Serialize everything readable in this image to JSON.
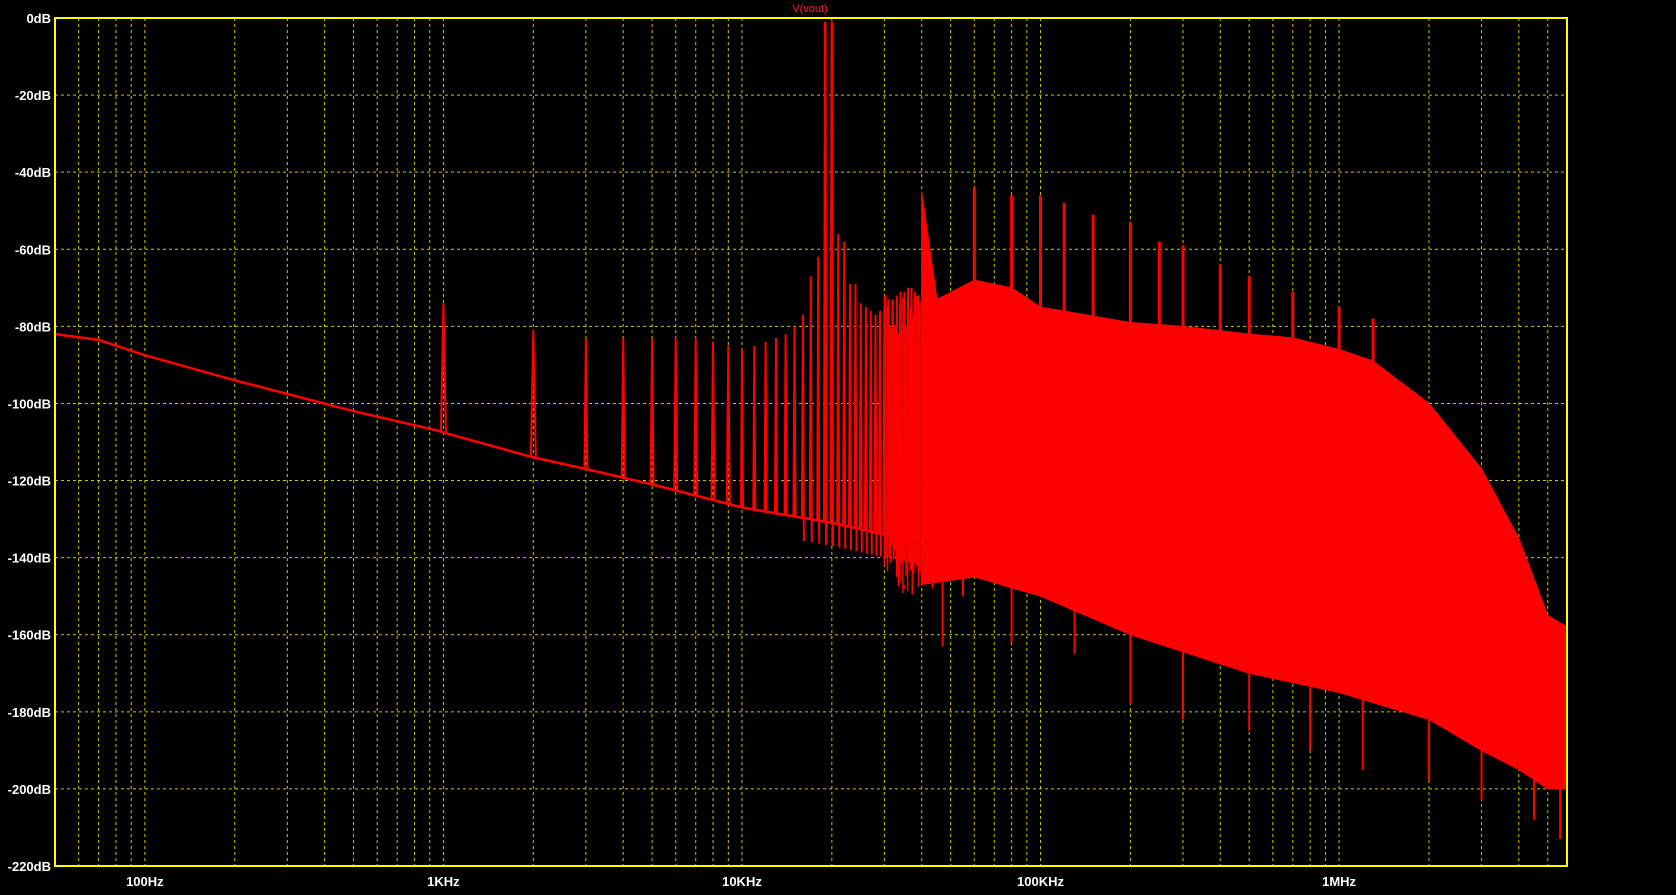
{
  "chart_data": {
    "type": "line",
    "title": "V(vout)",
    "xscale": "log",
    "xlim": [
      50,
      5800000
    ],
    "ylim": [
      -220,
      0
    ],
    "grid": true,
    "colors": {
      "background": "#000000",
      "frame": "#ffff00",
      "grid": "#c8c800",
      "trace": "#ff0000",
      "title": "#ff2020",
      "labels": "#ffffff"
    },
    "yticks": [
      {
        "value": 0,
        "label": "0dB"
      },
      {
        "value": -20,
        "label": "-20dB"
      },
      {
        "value": -40,
        "label": "-40dB"
      },
      {
        "value": -60,
        "label": "-60dB"
      },
      {
        "value": -80,
        "label": "-80dB"
      },
      {
        "value": -100,
        "label": "-100dB"
      },
      {
        "value": -120,
        "label": "-120dB"
      },
      {
        "value": -140,
        "label": "-140dB"
      },
      {
        "value": -160,
        "label": "-160dB"
      },
      {
        "value": -180,
        "label": "-180dB"
      },
      {
        "value": -200,
        "label": "-200dB"
      },
      {
        "value": -220,
        "label": "-220dB"
      }
    ],
    "xticks": [
      {
        "value": 100,
        "label": "100Hz"
      },
      {
        "value": 1000,
        "label": "1KHz"
      },
      {
        "value": 10000,
        "label": "10KHz"
      },
      {
        "value": 100000,
        "label": "100KHz"
      },
      {
        "value": 1000000,
        "label": "1MHz"
      }
    ],
    "series": [
      {
        "name": "V(vout)",
        "noise_floor": [
          [
            50,
            -82
          ],
          [
            70,
            -83.5
          ],
          [
            100,
            -87.5
          ],
          [
            200,
            -94
          ],
          [
            500,
            -102
          ],
          [
            950,
            -107
          ],
          [
            1050,
            -108
          ],
          [
            2000,
            -114
          ],
          [
            3000,
            -117
          ],
          [
            5000,
            -121
          ],
          [
            10000,
            -127
          ],
          [
            20000,
            -131
          ],
          [
            30000,
            -134
          ],
          [
            40000,
            -136
          ]
        ],
        "harmonics": [
          [
            1000,
            -74
          ],
          [
            2000,
            -81
          ],
          [
            3000,
            -83
          ],
          [
            4000,
            -83
          ],
          [
            5000,
            -83
          ],
          [
            6000,
            -83
          ],
          [
            7000,
            -83
          ],
          [
            8000,
            -84
          ],
          [
            9000,
            -85
          ],
          [
            10000,
            -86
          ],
          [
            11000,
            -85
          ],
          [
            12000,
            -84
          ],
          [
            13000,
            -83
          ],
          [
            14000,
            -82
          ],
          [
            15000,
            -80
          ],
          [
            16000,
            -77
          ],
          [
            17000,
            -67
          ],
          [
            18000,
            -62
          ],
          [
            19000,
            -1
          ],
          [
            20000,
            -1
          ],
          [
            21000,
            -56
          ],
          [
            22000,
            -58
          ],
          [
            23000,
            -69
          ],
          [
            24000,
            -69
          ],
          [
            25000,
            -74
          ],
          [
            26000,
            -75
          ],
          [
            27000,
            -76
          ],
          [
            28000,
            -77
          ],
          [
            29000,
            -76
          ],
          [
            30000,
            -75
          ],
          [
            31000,
            -73
          ],
          [
            32000,
            -73
          ],
          [
            33000,
            -72
          ],
          [
            34000,
            -71
          ],
          [
            35000,
            -71
          ],
          [
            36000,
            -70
          ],
          [
            37000,
            -70
          ],
          [
            38000,
            -71
          ],
          [
            39000,
            -72
          ]
        ],
        "band_top": [
          [
            40000,
            -45
          ],
          [
            45000,
            -73
          ],
          [
            60000,
            -68
          ],
          [
            80000,
            -70
          ],
          [
            100000,
            -75
          ],
          [
            200000,
            -79
          ],
          [
            300000,
            -80
          ],
          [
            500000,
            -82
          ],
          [
            700000,
            -83
          ],
          [
            1000000,
            -86
          ],
          [
            1300000,
            -89
          ],
          [
            2000000,
            -100
          ],
          [
            3000000,
            -117
          ],
          [
            4000000,
            -135
          ],
          [
            5000000,
            -155
          ],
          [
            5800000,
            -158
          ]
        ],
        "band_bottom": [
          [
            40000,
            -147
          ],
          [
            60000,
            -145
          ],
          [
            100000,
            -150
          ],
          [
            200000,
            -160
          ],
          [
            500000,
            -170
          ],
          [
            1000000,
            -175
          ],
          [
            2000000,
            -182
          ],
          [
            3000000,
            -190
          ],
          [
            4000000,
            -195
          ],
          [
            5000000,
            -200
          ],
          [
            5800000,
            -200
          ]
        ],
        "band_peaks": [
          [
            40000,
            -45
          ],
          [
            60000,
            -44
          ],
          [
            80000,
            -46
          ],
          [
            100000,
            -46
          ],
          [
            120000,
            -48
          ],
          [
            150000,
            -51
          ],
          [
            200000,
            -53
          ],
          [
            250000,
            -58
          ],
          [
            300000,
            -59
          ],
          [
            400000,
            -64
          ],
          [
            500000,
            -67
          ],
          [
            700000,
            -71
          ],
          [
            1000000,
            -75
          ],
          [
            1300000,
            -78
          ]
        ],
        "band_dips": [
          [
            35000,
            -148
          ],
          [
            47000,
            -163
          ],
          [
            55000,
            -150
          ],
          [
            80000,
            -162
          ],
          [
            130000,
            -165
          ],
          [
            200000,
            -178
          ],
          [
            300000,
            -182
          ],
          [
            500000,
            -185
          ],
          [
            800000,
            -190
          ],
          [
            1200000,
            -195
          ],
          [
            2000000,
            -198
          ],
          [
            3000000,
            -203
          ],
          [
            4500000,
            -208
          ],
          [
            5500000,
            -213
          ]
        ]
      }
    ]
  }
}
